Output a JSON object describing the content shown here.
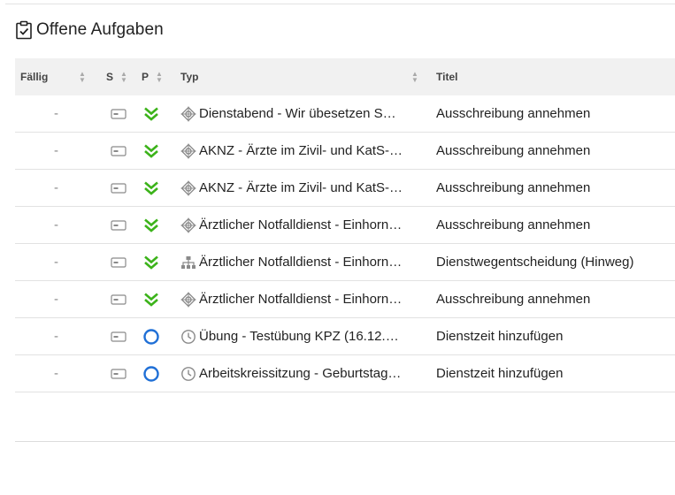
{
  "panel": {
    "title": "Offene Aufgaben",
    "title_icon": "clipboard-check-icon"
  },
  "table": {
    "headers": {
      "faellig": "Fällig",
      "s": "S",
      "p": "P",
      "typ": "Typ",
      "titel": "Titel"
    },
    "rows": [
      {
        "due": "-",
        "status_icon": "card-icon",
        "priority_icon": "double-chevron-down-icon",
        "type_icon": "target-icon",
        "typ": "Dienstabend - Wir übesetzen S…",
        "titel": "Ausschreibung annehmen"
      },
      {
        "due": "-",
        "status_icon": "card-icon",
        "priority_icon": "double-chevron-down-icon",
        "type_icon": "target-icon",
        "typ": "AKNZ - Ärzte im Zivil- und KatS-…",
        "titel": "Ausschreibung annehmen"
      },
      {
        "due": "-",
        "status_icon": "card-icon",
        "priority_icon": "double-chevron-down-icon",
        "type_icon": "target-icon",
        "typ": "AKNZ - Ärzte im Zivil- und KatS-…",
        "titel": "Ausschreibung annehmen"
      },
      {
        "due": "-",
        "status_icon": "card-icon",
        "priority_icon": "double-chevron-down-icon",
        "type_icon": "target-icon",
        "typ": "Ärztlicher Notfalldienst - Einhorn…",
        "titel": "Ausschreibung annehmen"
      },
      {
        "due": "-",
        "status_icon": "card-icon",
        "priority_icon": "double-chevron-down-icon",
        "type_icon": "hierarchy-icon",
        "typ": "Ärztlicher Notfalldienst - Einhorn…",
        "titel": "Dienstwegentscheidung (Hinweg)"
      },
      {
        "due": "-",
        "status_icon": "card-icon",
        "priority_icon": "double-chevron-down-icon",
        "type_icon": "target-icon",
        "typ": "Ärztlicher Notfalldienst - Einhorn…",
        "titel": "Ausschreibung annehmen"
      },
      {
        "due": "-",
        "status_icon": "card-icon",
        "priority_icon": "circle-icon",
        "type_icon": "clock-icon",
        "typ": "Übung - Testübung KPZ (16.12.…",
        "titel": "Dienstzeit hinzufügen"
      },
      {
        "due": "-",
        "status_icon": "card-icon",
        "priority_icon": "circle-icon",
        "type_icon": "clock-icon",
        "typ": "Arbeitskreissitzung - Geburtstag…",
        "titel": "Dienstzeit hinzufügen"
      }
    ]
  },
  "colors": {
    "priority_low": "#3cb31a",
    "priority_normal": "#1f6fd6",
    "icon_gray": "#8a8a8a",
    "header_bg": "#f1f1f1"
  }
}
